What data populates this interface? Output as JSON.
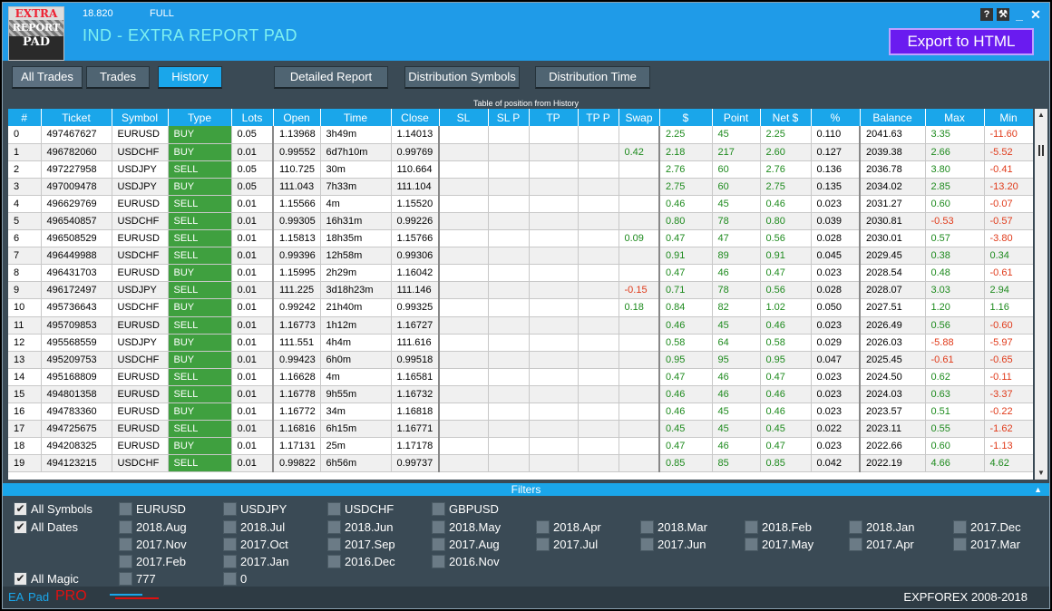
{
  "header": {
    "version": "18.820",
    "mode": "FULL",
    "title": "IND - EXTRA REPORT PAD",
    "logo": [
      "EXTRA",
      "REPORT",
      "PAD"
    ],
    "export_label": "Export to HTML",
    "buttons": [
      "?",
      "⚒",
      "_",
      "✕"
    ]
  },
  "tabs": [
    "All Trades",
    "Trades",
    "History",
    "Detailed Report",
    "Distribution Symbols",
    "Distribution Time"
  ],
  "table": {
    "caption": "Table of position from History",
    "columns": [
      "#",
      "Ticket",
      "Symbol",
      "Type",
      "Lots",
      "Open",
      "Time",
      "Close",
      "SL",
      "SL P",
      "TP",
      "TP P",
      "Swap",
      "$",
      "Point",
      "Net $",
      "%",
      "Balance",
      "Max",
      "Min"
    ],
    "rows": [
      [
        "0",
        "497467627",
        "EURUSD",
        "BUY",
        "0.05",
        "1.13968",
        "3h49m",
        "1.14013",
        "",
        "",
        "",
        "",
        "",
        "2.25",
        "45",
        "2.25",
        "0.110",
        "2041.63",
        "3.35",
        "-11.60"
      ],
      [
        "1",
        "496782060",
        "USDCHF",
        "BUY",
        "0.01",
        "0.99552",
        "6d7h10m",
        "0.99769",
        "",
        "",
        "",
        "",
        "0.42",
        "2.18",
        "217",
        "2.60",
        "0.127",
        "2039.38",
        "2.66",
        "-5.52"
      ],
      [
        "2",
        "497227958",
        "USDJPY",
        "SELL",
        "0.05",
        "110.725",
        "30m",
        "110.664",
        "",
        "",
        "",
        "",
        "",
        "2.76",
        "60",
        "2.76",
        "0.136",
        "2036.78",
        "3.80",
        "-0.41"
      ],
      [
        "3",
        "497009478",
        "USDJPY",
        "BUY",
        "0.05",
        "111.043",
        "7h33m",
        "111.104",
        "",
        "",
        "",
        "",
        "",
        "2.75",
        "60",
        "2.75",
        "0.135",
        "2034.02",
        "2.85",
        "-13.20"
      ],
      [
        "4",
        "496629769",
        "EURUSD",
        "SELL",
        "0.01",
        "1.15566",
        "4m",
        "1.15520",
        "",
        "",
        "",
        "",
        "",
        "0.46",
        "45",
        "0.46",
        "0.023",
        "2031.27",
        "0.60",
        "-0.07"
      ],
      [
        "5",
        "496540857",
        "USDCHF",
        "SELL",
        "0.01",
        "0.99305",
        "16h31m",
        "0.99226",
        "",
        "",
        "",
        "",
        "",
        "0.80",
        "78",
        "0.80",
        "0.039",
        "2030.81",
        "-0.53",
        "-0.57"
      ],
      [
        "6",
        "496508529",
        "EURUSD",
        "SELL",
        "0.01",
        "1.15813",
        "18h35m",
        "1.15766",
        "",
        "",
        "",
        "",
        "0.09",
        "0.47",
        "47",
        "0.56",
        "0.028",
        "2030.01",
        "0.57",
        "-3.80"
      ],
      [
        "7",
        "496449988",
        "USDCHF",
        "SELL",
        "0.01",
        "0.99396",
        "12h58m",
        "0.99306",
        "",
        "",
        "",
        "",
        "",
        "0.91",
        "89",
        "0.91",
        "0.045",
        "2029.45",
        "0.38",
        "0.34"
      ],
      [
        "8",
        "496431703",
        "EURUSD",
        "BUY",
        "0.01",
        "1.15995",
        "2h29m",
        "1.16042",
        "",
        "",
        "",
        "",
        "",
        "0.47",
        "46",
        "0.47",
        "0.023",
        "2028.54",
        "0.48",
        "-0.61"
      ],
      [
        "9",
        "496172497",
        "USDJPY",
        "SELL",
        "0.01",
        "111.225",
        "3d18h23m",
        "111.146",
        "",
        "",
        "",
        "",
        "-0.15",
        "0.71",
        "78",
        "0.56",
        "0.028",
        "2028.07",
        "3.03",
        "2.94"
      ],
      [
        "10",
        "495736643",
        "USDCHF",
        "BUY",
        "0.01",
        "0.99242",
        "21h40m",
        "0.99325",
        "",
        "",
        "",
        "",
        "0.18",
        "0.84",
        "82",
        "1.02",
        "0.050",
        "2027.51",
        "1.20",
        "1.16"
      ],
      [
        "11",
        "495709853",
        "EURUSD",
        "SELL",
        "0.01",
        "1.16773",
        "1h12m",
        "1.16727",
        "",
        "",
        "",
        "",
        "",
        "0.46",
        "45",
        "0.46",
        "0.023",
        "2026.49",
        "0.56",
        "-0.60"
      ],
      [
        "12",
        "495568559",
        "USDJPY",
        "BUY",
        "0.01",
        "111.551",
        "4h4m",
        "111.616",
        "",
        "",
        "",
        "",
        "",
        "0.58",
        "64",
        "0.58",
        "0.029",
        "2026.03",
        "-5.88",
        "-5.97"
      ],
      [
        "13",
        "495209753",
        "USDCHF",
        "BUY",
        "0.01",
        "0.99423",
        "6h0m",
        "0.99518",
        "",
        "",
        "",
        "",
        "",
        "0.95",
        "95",
        "0.95",
        "0.047",
        "2025.45",
        "-0.61",
        "-0.65"
      ],
      [
        "14",
        "495168809",
        "EURUSD",
        "SELL",
        "0.01",
        "1.16628",
        "4m",
        "1.16581",
        "",
        "",
        "",
        "",
        "",
        "0.47",
        "46",
        "0.47",
        "0.023",
        "2024.50",
        "0.62",
        "-0.11"
      ],
      [
        "15",
        "494801358",
        "EURUSD",
        "SELL",
        "0.01",
        "1.16778",
        "9h55m",
        "1.16732",
        "",
        "",
        "",
        "",
        "",
        "0.46",
        "46",
        "0.46",
        "0.023",
        "2024.03",
        "0.63",
        "-3.37"
      ],
      [
        "16",
        "494783360",
        "EURUSD",
        "BUY",
        "0.01",
        "1.16772",
        "34m",
        "1.16818",
        "",
        "",
        "",
        "",
        "",
        "0.46",
        "45",
        "0.46",
        "0.023",
        "2023.57",
        "0.51",
        "-0.22"
      ],
      [
        "17",
        "494725675",
        "EURUSD",
        "SELL",
        "0.01",
        "1.16816",
        "6h15m",
        "1.16771",
        "",
        "",
        "",
        "",
        "",
        "0.45",
        "45",
        "0.45",
        "0.022",
        "2023.11",
        "0.55",
        "-1.62"
      ],
      [
        "18",
        "494208325",
        "EURUSD",
        "BUY",
        "0.01",
        "1.17131",
        "25m",
        "1.17178",
        "",
        "",
        "",
        "",
        "",
        "0.47",
        "46",
        "0.47",
        "0.023",
        "2022.66",
        "0.60",
        "-1.13"
      ],
      [
        "19",
        "494123215",
        "USDCHF",
        "SELL",
        "0.01",
        "0.99822",
        "6h56m",
        "0.99737",
        "",
        "",
        "",
        "",
        "",
        "0.85",
        "85",
        "0.85",
        "0.042",
        "2022.19",
        "4.66",
        "4.62"
      ]
    ]
  },
  "filters": {
    "title": "Filters",
    "all_symbols": "All Symbols",
    "all_dates": "All Dates",
    "all_magic": "All Magic",
    "symbols": [
      "EURUSD",
      "USDJPY",
      "USDCHF",
      "GBPUSD"
    ],
    "dates_row1": [
      "2018.Aug",
      "2018.Jul",
      "2018.Jun",
      "2018.May",
      "2018.Apr",
      "2018.Mar",
      "2018.Feb",
      "2018.Jan",
      "2017.Dec"
    ],
    "dates_row2": [
      "2017.Nov",
      "2017.Oct",
      "2017.Sep",
      "2017.Aug",
      "2017.Jul",
      "2017.Jun",
      "2017.May",
      "2017.Apr",
      "2017.Mar"
    ],
    "dates_row3": [
      "2017.Feb",
      "2017.Jan",
      "2016.Dec",
      "2016.Nov"
    ],
    "magic": [
      "777",
      "0"
    ]
  },
  "footer": {
    "ea": "EA",
    "pad": "Pad",
    "pro": "PRO",
    "copyright": "EXPFOREX 2008-2018"
  },
  "colors": {
    "accent": "#1aa6ea",
    "export": "#6a1bf0",
    "buy_sell_cell": "#3fa03f",
    "positive": "#1d8a1d",
    "negative": "#e03a1a"
  }
}
